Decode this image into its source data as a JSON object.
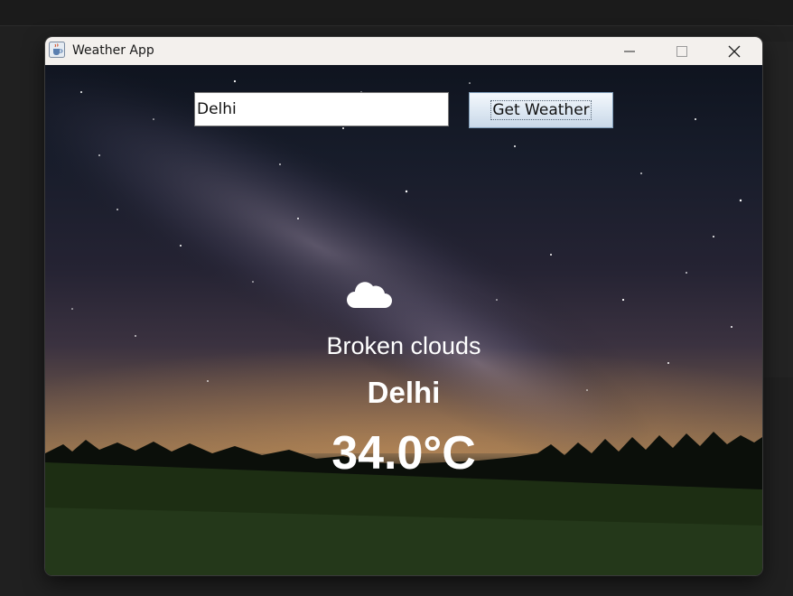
{
  "window": {
    "title": "Weather App",
    "app_icon": "java-cup-icon",
    "controls": [
      "minimize-icon",
      "maximize-icon",
      "close-icon"
    ]
  },
  "search": {
    "value": "Delhi",
    "button_label": "Get Weather"
  },
  "weather": {
    "icon": "cloud-icon",
    "description": "Broken clouds",
    "city": "Delhi",
    "temperature": "34.0°C"
  },
  "colors": {
    "text": "#ffffff",
    "button_border": "#7f9db9",
    "titlebar": "#f3f0ed"
  }
}
